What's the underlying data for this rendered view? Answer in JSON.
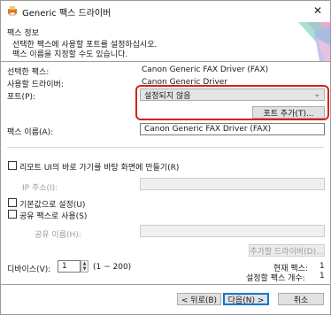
{
  "window": {
    "title": "Generic 팩스 드라이버",
    "close_glyph": "✕"
  },
  "header": {
    "title": "팩스 정보",
    "desc_line1": "선택한 팩스에 사용할 포트를 설정하십시오.",
    "desc_line2": "팩스 이름을 지정할 수도 있습니다."
  },
  "info": {
    "selected_fax_label": "선택한 팩스:",
    "selected_fax_value": "Canon Generic FAX Driver (FAX)",
    "driver_label": "사용할 드라이버:",
    "driver_value": "Canon Generic Driver",
    "port_label": "포트(P):",
    "port_value": "설정되지 않음",
    "add_port_label": "포트 추가(T)...",
    "fax_name_label": "팩스 이름(A):",
    "fax_name_value": "Canon Generic FAX Driver (FAX)"
  },
  "options": {
    "shortcut_label": "리모트 UI의 바로 가기를 바탕 화면에 만들기(R)",
    "ip_label": "IP 주소(I):",
    "default_label": "기본값으로 설정(U)",
    "share_label": "공유 팩스로 사용(S)",
    "share_name_label": "공유 이름(H):",
    "add_driver_label": "추가할 드라이버(D)..."
  },
  "devices": {
    "label": "디바이스(V):",
    "value": "1",
    "range": "(1 ~ 200)",
    "current_label": "현재 팩스:",
    "current_value": "1",
    "planned_label": "설정할 팩스 개수:",
    "planned_value": "1"
  },
  "footer": {
    "back_label": "< 뒤로(B)",
    "next_label": "다음(N) >",
    "cancel_label": "취소"
  },
  "colors": {
    "highlight": "#d42020",
    "primary_border": "#0078d7",
    "icon": "#e07a1f"
  },
  "icons": {
    "app": "printer-fax-icon",
    "close": "close-icon",
    "dropdown": "chevron-down-icon",
    "spin_up": "triangle-up-icon",
    "spin_down": "triangle-down-icon"
  }
}
